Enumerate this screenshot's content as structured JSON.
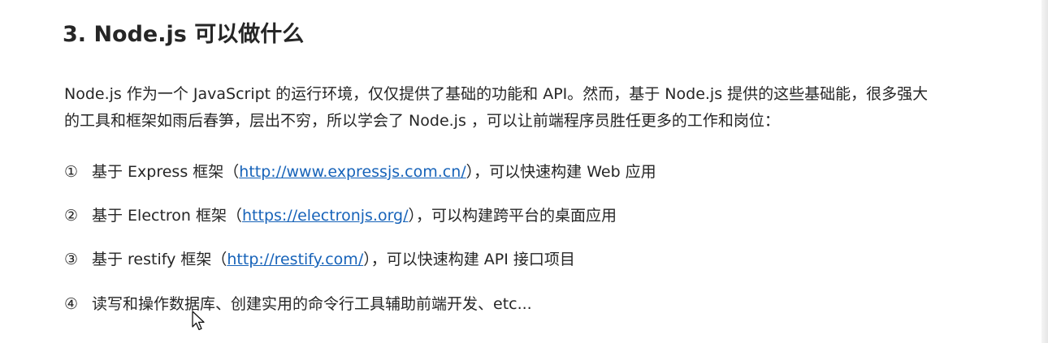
{
  "heading": "3. Node.js 可以做什么",
  "intro": {
    "line1": "Node.js 作为一个 JavaScript 的运行环境，仅仅提供了基础的功能和 API。然而，基于 Node.js 提供的这些基础能，很多强大",
    "line2": "的工具和框架如雨后春笋，层出不穷，所以学会了 Node.js ，可以让前端程序员胜任更多的工作和岗位："
  },
  "items": [
    {
      "num": "①",
      "prefix": "基于 Express 框架（",
      "link": "http://www.expressjs.com.cn/",
      "suffix": "），可以快速构建 Web 应用"
    },
    {
      "num": "②",
      "prefix": "基于 Electron 框架（",
      "link": "https://electronjs.org/",
      "suffix": "），可以构建跨平台的桌面应用"
    },
    {
      "num": "③",
      "prefix": "基于 restify 框架（",
      "link": "http://restify.com/",
      "suffix": "），可以快速构建 API 接口项目"
    },
    {
      "num": "④",
      "text": "读写和操作数据库、创建实用的命令行工具辅助前端开发、etc..."
    }
  ],
  "colors": {
    "text": "#262626",
    "link": "#1763b9",
    "background": "#ffffff"
  },
  "cursor_icon": "mouse-pointer-icon"
}
